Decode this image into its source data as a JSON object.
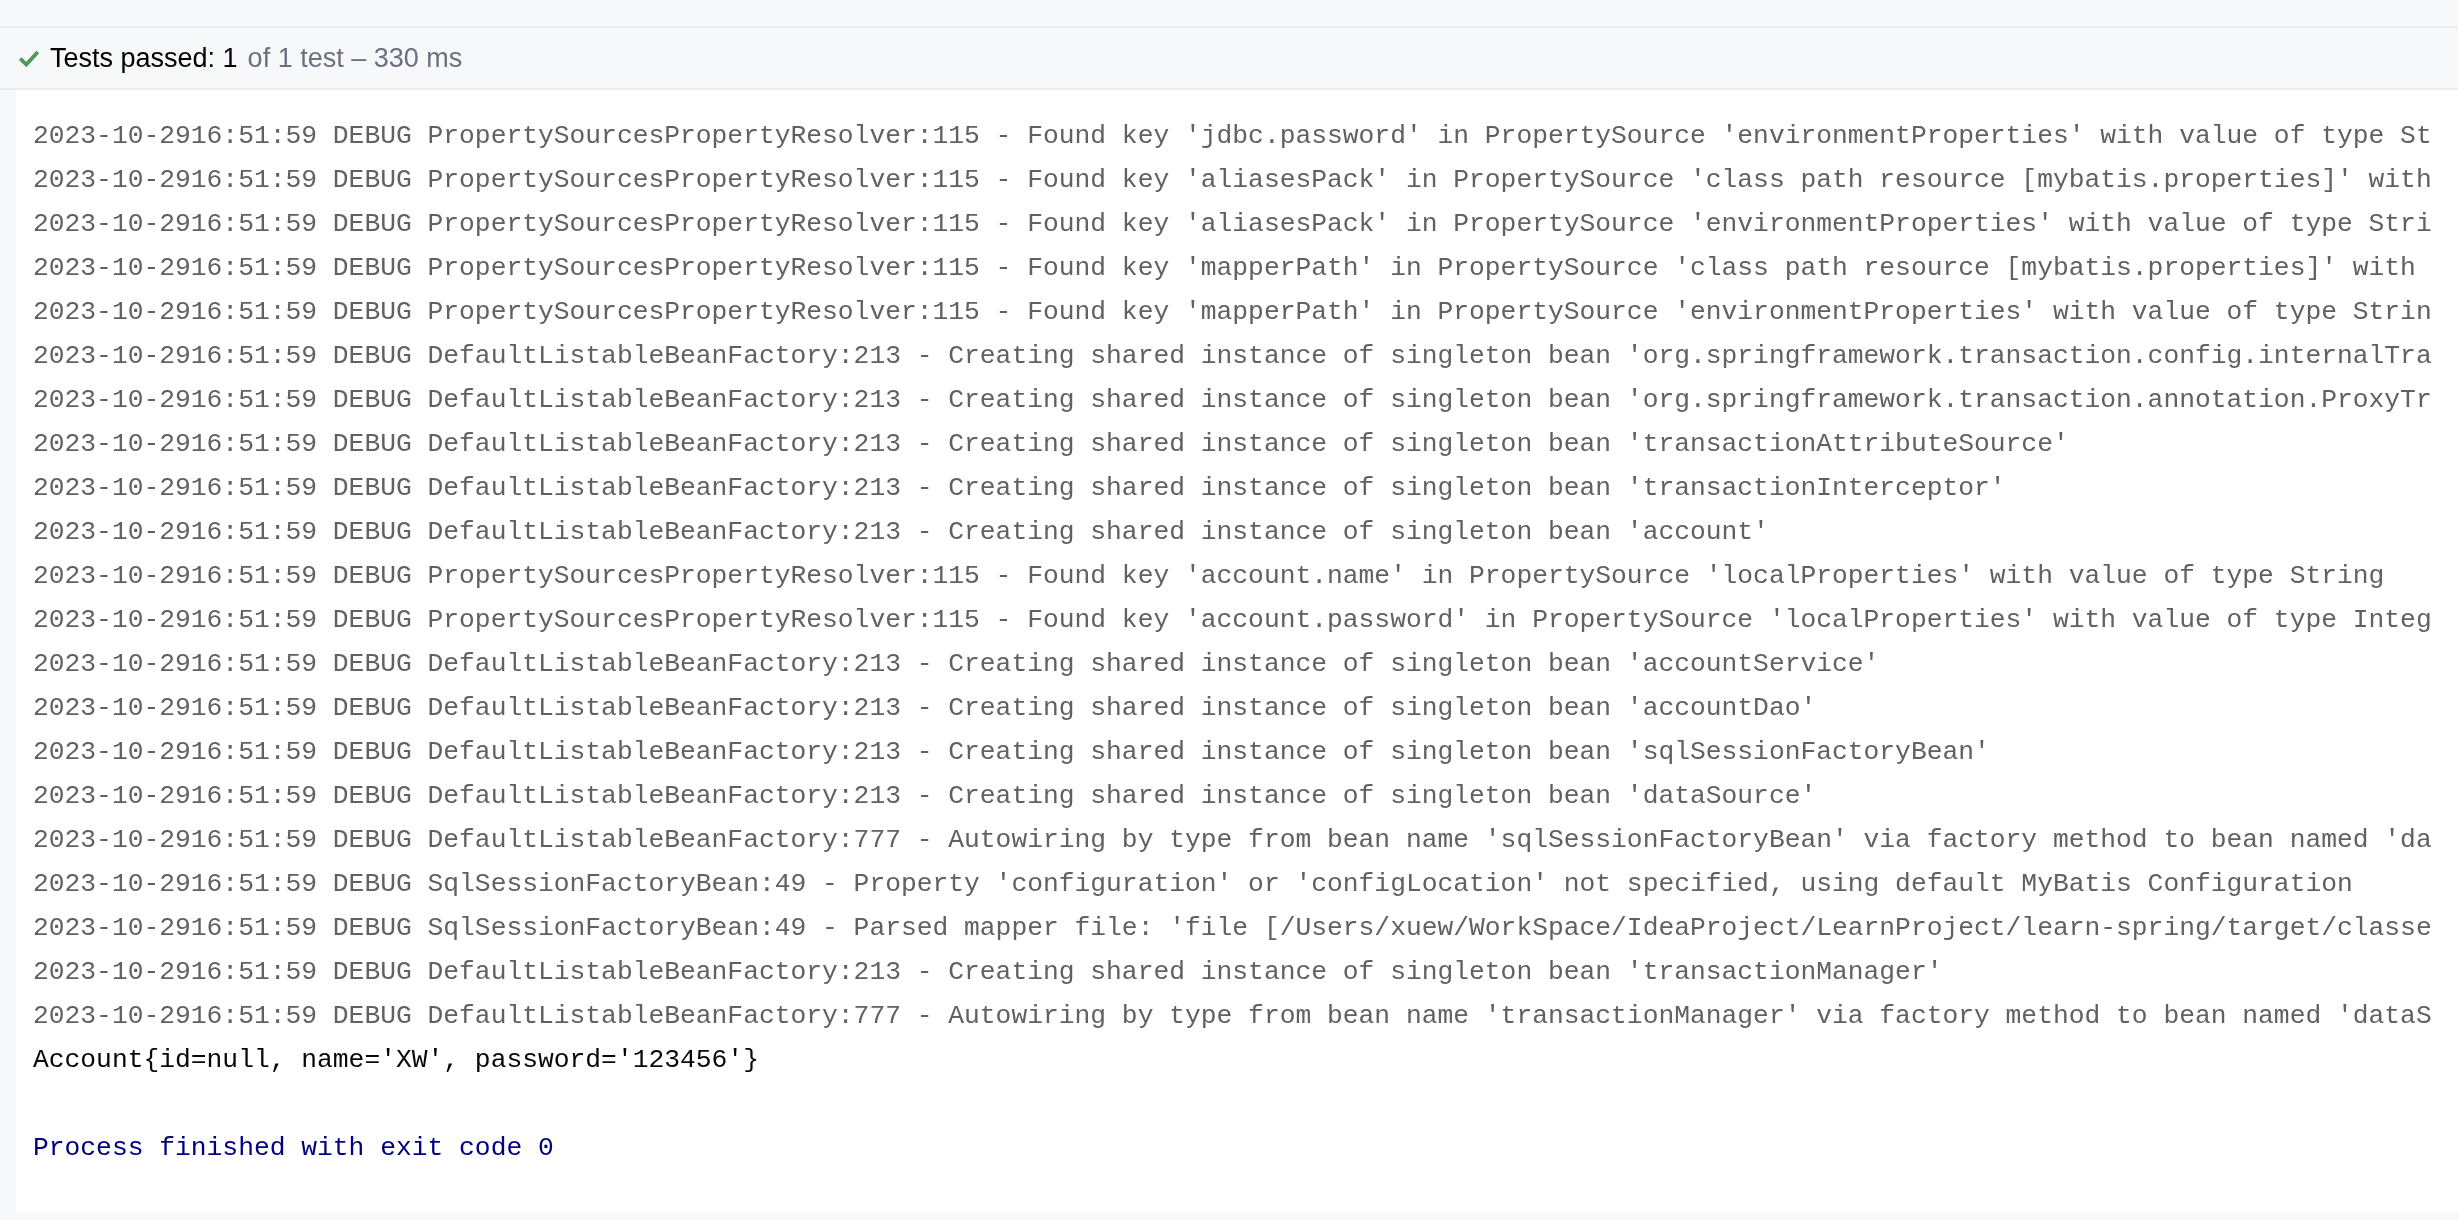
{
  "status_bar": {
    "passed": true,
    "label": "Tests passed: 1",
    "detail": "of 1 test – 330 ms"
  },
  "console": {
    "lines": [
      {
        "kind": "log",
        "text": "2023-10-2916:51:59 DEBUG PropertySourcesPropertyResolver:115 - Found key 'jdbc.password' in PropertySource 'environmentProperties' with value of type St"
      },
      {
        "kind": "log",
        "text": "2023-10-2916:51:59 DEBUG PropertySourcesPropertyResolver:115 - Found key 'aliasesPack' in PropertySource 'class path resource [mybatis.properties]' with"
      },
      {
        "kind": "log",
        "text": "2023-10-2916:51:59 DEBUG PropertySourcesPropertyResolver:115 - Found key 'aliasesPack' in PropertySource 'environmentProperties' with value of type Stri"
      },
      {
        "kind": "log",
        "text": "2023-10-2916:51:59 DEBUG PropertySourcesPropertyResolver:115 - Found key 'mapperPath' in PropertySource 'class path resource [mybatis.properties]' with"
      },
      {
        "kind": "log",
        "text": "2023-10-2916:51:59 DEBUG PropertySourcesPropertyResolver:115 - Found key 'mapperPath' in PropertySource 'environmentProperties' with value of type Strin"
      },
      {
        "kind": "log",
        "text": "2023-10-2916:51:59 DEBUG DefaultListableBeanFactory:213 - Creating shared instance of singleton bean 'org.springframework.transaction.config.internalTra"
      },
      {
        "kind": "log",
        "text": "2023-10-2916:51:59 DEBUG DefaultListableBeanFactory:213 - Creating shared instance of singleton bean 'org.springframework.transaction.annotation.ProxyTr"
      },
      {
        "kind": "log",
        "text": "2023-10-2916:51:59 DEBUG DefaultListableBeanFactory:213 - Creating shared instance of singleton bean 'transactionAttributeSource'"
      },
      {
        "kind": "log",
        "text": "2023-10-2916:51:59 DEBUG DefaultListableBeanFactory:213 - Creating shared instance of singleton bean 'transactionInterceptor'"
      },
      {
        "kind": "log",
        "text": "2023-10-2916:51:59 DEBUG DefaultListableBeanFactory:213 - Creating shared instance of singleton bean 'account'"
      },
      {
        "kind": "log",
        "text": "2023-10-2916:51:59 DEBUG PropertySourcesPropertyResolver:115 - Found key 'account.name' in PropertySource 'localProperties' with value of type String"
      },
      {
        "kind": "log",
        "text": "2023-10-2916:51:59 DEBUG PropertySourcesPropertyResolver:115 - Found key 'account.password' in PropertySource 'localProperties' with value of type Integ"
      },
      {
        "kind": "log",
        "text": "2023-10-2916:51:59 DEBUG DefaultListableBeanFactory:213 - Creating shared instance of singleton bean 'accountService'"
      },
      {
        "kind": "log",
        "text": "2023-10-2916:51:59 DEBUG DefaultListableBeanFactory:213 - Creating shared instance of singleton bean 'accountDao'"
      },
      {
        "kind": "log",
        "text": "2023-10-2916:51:59 DEBUG DefaultListableBeanFactory:213 - Creating shared instance of singleton bean 'sqlSessionFactoryBean'"
      },
      {
        "kind": "log",
        "text": "2023-10-2916:51:59 DEBUG DefaultListableBeanFactory:213 - Creating shared instance of singleton bean 'dataSource'"
      },
      {
        "kind": "log",
        "text": "2023-10-2916:51:59 DEBUG DefaultListableBeanFactory:777 - Autowiring by type from bean name 'sqlSessionFactoryBean' via factory method to bean named 'da"
      },
      {
        "kind": "log",
        "text": "2023-10-2916:51:59 DEBUG SqlSessionFactoryBean:49 - Property 'configuration' or 'configLocation' not specified, using default MyBatis Configuration"
      },
      {
        "kind": "log",
        "text": "2023-10-2916:51:59 DEBUG SqlSessionFactoryBean:49 - Parsed mapper file: 'file [/Users/xuew/WorkSpace/IdeaProject/LearnProject/learn-spring/target/classe"
      },
      {
        "kind": "log",
        "text": "2023-10-2916:51:59 DEBUG DefaultListableBeanFactory:213 - Creating shared instance of singleton bean 'transactionManager'"
      },
      {
        "kind": "log",
        "text": "2023-10-2916:51:59 DEBUG DefaultListableBeanFactory:777 - Autowiring by type from bean name 'transactionManager' via factory method to bean named 'dataS"
      },
      {
        "kind": "output",
        "text": "Account{id=null, name='XW', password='123456'}"
      },
      {
        "kind": "system",
        "text": "Process finished with exit code 0"
      }
    ]
  }
}
